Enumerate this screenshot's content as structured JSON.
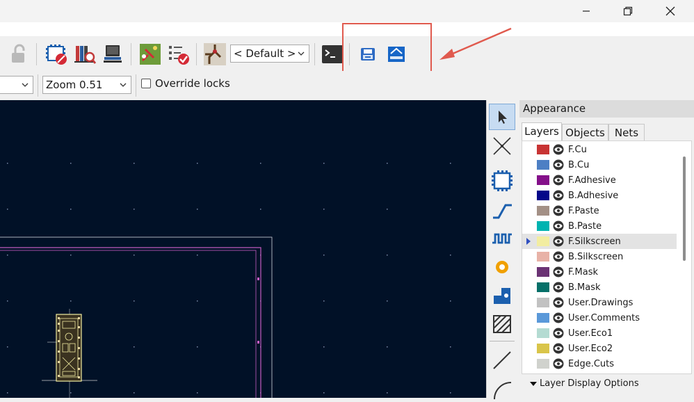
{
  "window_controls": {
    "minimize_icon": "minimize-icon",
    "restore_icon": "restore-icon",
    "close_icon": "close-icon"
  },
  "toolbar": {
    "track_width_select": "< Default >",
    "zoom_select": "Zoom 0.51",
    "override_locks_label": "Override locks",
    "override_locks_checked": false
  },
  "appearance": {
    "title": "Appearance",
    "tabs": [
      {
        "label": "Layers"
      },
      {
        "label": "Objects"
      },
      {
        "label": "Nets"
      }
    ],
    "active_tab": "Layers",
    "selected_layer": "F.Silkscreen",
    "layers": [
      {
        "name": "F.Cu",
        "color": "#c83434"
      },
      {
        "name": "B.Cu",
        "color": "#4d7fc4"
      },
      {
        "name": "F.Adhesive",
        "color": "#84108a"
      },
      {
        "name": "B.Adhesive",
        "color": "#05088a"
      },
      {
        "name": "F.Paste",
        "color": "#a39086"
      },
      {
        "name": "B.Paste",
        "color": "#00b3b0"
      },
      {
        "name": "F.Silkscreen",
        "color": "#f2eda1"
      },
      {
        "name": "B.Silkscreen",
        "color": "#e8b2a7"
      },
      {
        "name": "F.Mask",
        "color": "#6b3374"
      },
      {
        "name": "B.Mask",
        "color": "#067069"
      },
      {
        "name": "User.Drawings",
        "color": "#c2c2c2"
      },
      {
        "name": "User.Comments",
        "color": "#5b99d9"
      },
      {
        "name": "User.Eco1",
        "color": "#b4dbd2"
      },
      {
        "name": "User.Eco2",
        "color": "#d9c54a"
      },
      {
        "name": "Edge.Cuts",
        "color": "#d0d2cd"
      }
    ],
    "display_options_label": "Layer Display Options"
  },
  "colors": {
    "canvas_bg": "#011127",
    "highlight": "#e05a4e",
    "board_outline": "#c85dc4"
  }
}
